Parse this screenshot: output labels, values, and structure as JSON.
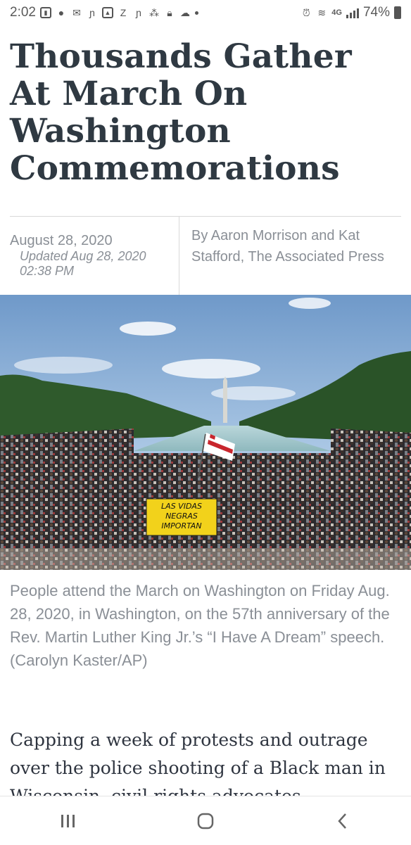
{
  "status_bar": {
    "time": "2:02",
    "network": "4G",
    "battery": "74%",
    "notification_icons": [
      "lock-app-icon",
      "account-icon",
      "mail-icon",
      "app-n-icon",
      "gallery-icon",
      "app-z-icon",
      "app-n-icon",
      "paw-icon",
      "lock-icon",
      "cloud-icon",
      "dot"
    ],
    "system_icons": [
      "alarm-icon",
      "wifi-icon",
      "signal-icon",
      "battery-icon"
    ]
  },
  "article": {
    "headline": "Thousands Gather At March On Washington Commemorations",
    "date": "August 28, 2020",
    "updated": "Updated Aug 28, 2020 02:38 PM",
    "byline": "By Aaron Morrison and Kat Stafford, The Associated Press",
    "photo_sign_text": "LAS VIDAS NEGRAS IMPORTAN",
    "caption": "People attend the March on Washington on Friday Aug. 28, 2020, in Washington, on the 57th anniversary of the Rev. Martin Luther King Jr.’s “I Have A Dream” speech. (Carolyn Kaster/AP)",
    "body_start": "Capping a week of protests and outrage over the police shooting of a Black man in Wisconsin, civil rights advocates"
  },
  "nav_bar": {
    "buttons": [
      "recent-apps-icon",
      "home-icon",
      "back-icon"
    ]
  }
}
